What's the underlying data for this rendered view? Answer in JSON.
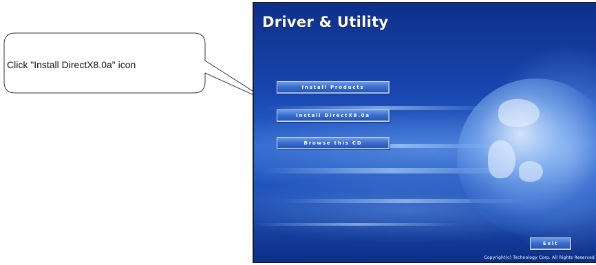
{
  "callout": {
    "text": "Click \"Install DirectX8.0a\" icon"
  },
  "installer": {
    "title": "Driver & Utility",
    "buttons": {
      "install_products": "Install Products",
      "install_directx": "Install DirectX8.0a",
      "browse_cd": "Browse this CD",
      "exit": "Exit"
    },
    "footer": "Copyright(c) Technology Corp. All Rights Reserved"
  },
  "colors": {
    "background_top": "#0e2f8a",
    "background_mid": "#2a63cc",
    "button_fill": "#3b6fcf",
    "button_border": "#c9dcff",
    "title_text": "#ffffff"
  },
  "icons": {
    "globe": "globe-artwork"
  }
}
